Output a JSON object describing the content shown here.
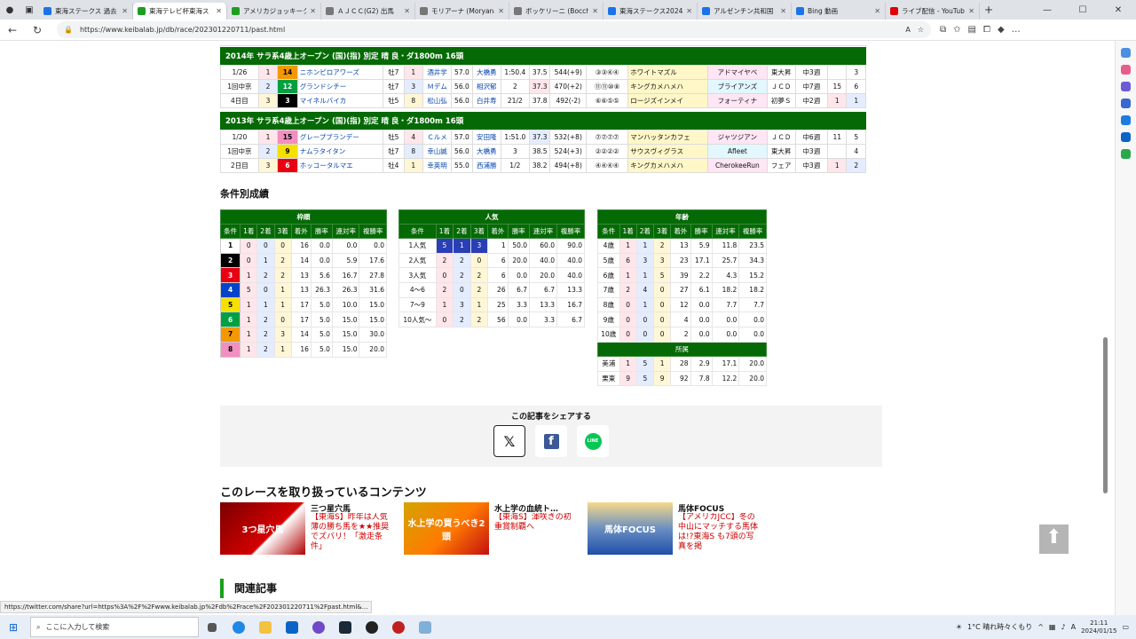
{
  "browser": {
    "tabs": [
      {
        "title": "東海ステークス 過去",
        "color": "#1a73e8"
      },
      {
        "title": "東海テレビ杯東海ス",
        "color": "#1e9e1e",
        "active": true
      },
      {
        "title": "アメリカジョッキーク",
        "color": "#1e9e1e"
      },
      {
        "title": "ＡＪＣＣ(G2) 出馬",
        "color": "#777777"
      },
      {
        "title": "モリアーナ (Moryana",
        "color": "#777777"
      },
      {
        "title": "ボッケリーニ (Bocche",
        "color": "#777777"
      },
      {
        "title": "東海ステークス2024",
        "color": "#1a73e8"
      },
      {
        "title": "アルゼンチン共和国",
        "color": "#1a73e8"
      },
      {
        "title": "Bing 動画",
        "color": "#1a73e8"
      },
      {
        "title": "ライブ配信 - YouTub",
        "color": "#e00000"
      }
    ],
    "url": "https://www.keibalab.jp/db/race/202301220711/past.html",
    "status_url": "https://twitter.com/share?url=https%3A%2F%2Fwww.keibalab.jp%2Fdb%2Frace%2F202301220711%2Fpast.html&..."
  },
  "past_races": [
    {
      "header": "2014年 サラ系4歳上オープン (国)(指) 別定 晴 良・ダ1800m 16頭",
      "date": [
        "1/26",
        "1回中京",
        "4日目"
      ],
      "rows": [
        {
          "rank": "1",
          "num": "14",
          "horse": "ニホンピロアワーズ",
          "sex": "牡7",
          "pop": "1",
          "jockey": "酒井学",
          "weight": "57.0",
          "trainer": "大橋勇",
          "time": "1:50.4",
          "last": "37.5",
          "bw": "544(+9)",
          "pos": "③③④④",
          "sire": "ホワイトマズル",
          "dam_sire": "アドマイヤベ",
          "owner": "東大昇",
          "prep": "中3週",
          "r1": "",
          "r2": "3"
        },
        {
          "rank": "2",
          "num": "12",
          "horse": "グランドシチー",
          "sex": "牡7",
          "pop": "3",
          "jockey": "Ｍデム",
          "weight": "56.0",
          "trainer": "相沢郁",
          "time": "2",
          "last": "37.3",
          "bw": "470(+2)",
          "pos": "⑪⑪⑩⑧",
          "sire": "キングカメハメハ",
          "dam_sire": "ブライアンズ",
          "owner": "ＪＣＤ",
          "prep": "中7週",
          "r1": "15",
          "r2": "6"
        },
        {
          "rank": "3",
          "num": "3",
          "horse": "マイネルバイカ",
          "sex": "牡5",
          "pop": "8",
          "jockey": "松山弘",
          "weight": "56.0",
          "trainer": "白井寿",
          "time": "21/2",
          "last": "37.8",
          "bw": "492(-2)",
          "pos": "⑥⑥⑤⑤",
          "sire": "ロージズインメイ",
          "dam_sire": "フォーティナ",
          "owner": "初夢Ｓ",
          "prep": "中2週",
          "r1": "1",
          "r2": "1"
        }
      ]
    },
    {
      "header": "2013年 サラ系4歳上オープン (国)(指) 別定 晴 良・ダ1800m 16頭",
      "date": [
        "1/20",
        "1回中京",
        "2日目"
      ],
      "rows": [
        {
          "rank": "1",
          "num": "15",
          "horse": "グレープブランデー",
          "sex": "牡5",
          "pop": "4",
          "jockey": "Ｃルメ",
          "weight": "57.0",
          "trainer": "安田隆",
          "time": "1:51.0",
          "last": "37.3",
          "bw": "532(+8)",
          "pos": "⑦⑦⑦⑦",
          "sire": "マンハッタンカフェ",
          "dam_sire": "ジャツジアン",
          "owner": "ＪＣＤ",
          "prep": "中6週",
          "r1": "11",
          "r2": "5"
        },
        {
          "rank": "2",
          "num": "9",
          "horse": "ナムラタイタン",
          "sex": "牡7",
          "pop": "8",
          "jockey": "幸山誠",
          "weight": "56.0",
          "trainer": "大橋勇",
          "time": "3",
          "last": "38.5",
          "bw": "524(+3)",
          "pos": "②②②②",
          "sire": "サウスヴィグラス",
          "dam_sire": "Afleet",
          "owner": "東大昇",
          "prep": "中3週",
          "r1": "",
          "r2": "4"
        },
        {
          "rank": "3",
          "num": "6",
          "horse": "ホッコータルマエ",
          "sex": "牡4",
          "pop": "1",
          "jockey": "幸英明",
          "weight": "55.0",
          "trainer": "西浦勝",
          "time": "1/2",
          "last": "38.2",
          "bw": "494(+8)",
          "pos": "④④④④",
          "sire": "キングカメハメハ",
          "dam_sire": "CherokeeRun",
          "owner": "フェア",
          "prep": "中3週",
          "r1": "1",
          "r2": "2"
        }
      ]
    }
  ],
  "cond_title": "条件別成績",
  "waku": {
    "title": "枠順",
    "cols": [
      "条件",
      "1着",
      "2着",
      "3着",
      "着外",
      "勝率",
      "連対率",
      "複勝率"
    ],
    "rows": [
      [
        "1",
        "0",
        "0",
        "0",
        "16",
        "0.0",
        "0.0",
        "0.0"
      ],
      [
        "2",
        "0",
        "1",
        "2",
        "14",
        "0.0",
        "5.9",
        "17.6"
      ],
      [
        "3",
        "1",
        "2",
        "2",
        "13",
        "5.6",
        "16.7",
        "27.8"
      ],
      [
        "4",
        "5",
        "0",
        "1",
        "13",
        "26.3",
        "26.3",
        "31.6"
      ],
      [
        "5",
        "1",
        "1",
        "1",
        "17",
        "5.0",
        "10.0",
        "15.0"
      ],
      [
        "6",
        "1",
        "2",
        "0",
        "17",
        "5.0",
        "15.0",
        "15.0"
      ],
      [
        "7",
        "1",
        "2",
        "3",
        "14",
        "5.0",
        "15.0",
        "30.0"
      ],
      [
        "8",
        "1",
        "2",
        "1",
        "16",
        "5.0",
        "15.0",
        "20.0"
      ]
    ]
  },
  "ninki": {
    "title": "人気",
    "cols": [
      "条件",
      "1着",
      "2着",
      "3着",
      "着外",
      "勝率",
      "連対率",
      "複勝率"
    ],
    "rows": [
      [
        "1人気",
        "5",
        "1",
        "3",
        "1",
        "50.0",
        "60.0",
        "90.0"
      ],
      [
        "2人気",
        "2",
        "2",
        "0",
        "6",
        "20.0",
        "40.0",
        "40.0"
      ],
      [
        "3人気",
        "0",
        "2",
        "2",
        "6",
        "0.0",
        "20.0",
        "40.0"
      ],
      [
        "4～6",
        "2",
        "0",
        "2",
        "26",
        "6.7",
        "6.7",
        "13.3"
      ],
      [
        "7～9",
        "1",
        "3",
        "1",
        "25",
        "3.3",
        "13.3",
        "16.7"
      ],
      [
        "10人気～",
        "0",
        "2",
        "2",
        "56",
        "0.0",
        "3.3",
        "6.7"
      ]
    ]
  },
  "nenrei": {
    "title": "年齢",
    "cols": [
      "条件",
      "1着",
      "2着",
      "3着",
      "着外",
      "勝率",
      "連対率",
      "複勝率"
    ],
    "rows": [
      [
        "4歳",
        "1",
        "1",
        "2",
        "13",
        "5.9",
        "11.8",
        "23.5"
      ],
      [
        "5歳",
        "6",
        "3",
        "3",
        "23",
        "17.1",
        "25.7",
        "34.3"
      ],
      [
        "6歳",
        "1",
        "1",
        "5",
        "39",
        "2.2",
        "4.3",
        "15.2"
      ],
      [
        "7歳",
        "2",
        "4",
        "0",
        "27",
        "6.1",
        "18.2",
        "18.2"
      ],
      [
        "8歳",
        "0",
        "1",
        "0",
        "12",
        "0.0",
        "7.7",
        "7.7"
      ],
      [
        "9歳",
        "0",
        "0",
        "0",
        "4",
        "0.0",
        "0.0",
        "0.0"
      ],
      [
        "10歳",
        "0",
        "0",
        "0",
        "2",
        "0.0",
        "0.0",
        "0.0"
      ]
    ],
    "sub_title": "所属",
    "sub_rows": [
      [
        "美浦",
        "1",
        "5",
        "1",
        "28",
        "2.9",
        "17.1",
        "20.0"
      ],
      [
        "栗東",
        "9",
        "5",
        "9",
        "92",
        "7.8",
        "12.2",
        "20.0"
      ]
    ]
  },
  "waku_colors": [
    "#ffffff",
    "#000000",
    "#e60012",
    "#0044cc",
    "#f5e000",
    "#00a040",
    "#f39800",
    "#f28fc0"
  ],
  "waku_text": [
    "#000000",
    "#ffffff",
    "#ffffff",
    "#ffffff",
    "#000000",
    "#ffffff",
    "#000000",
    "#000000"
  ],
  "share": {
    "title": "この記事をシェアする",
    "x": "𝕏",
    "facebook": "f",
    "line": "LINE"
  },
  "contents": {
    "title": "このレースを取り扱っているコンテンツ",
    "cards": [
      {
        "name": "三つ星穴馬",
        "img": "3つ星穴馬",
        "desc": "【東海S】昨年は人気薄の勝ち馬を★★推奨でズバリ！「激走条件」"
      },
      {
        "name": "水上学の血統ト…",
        "img": "水上学の買うべき2頭",
        "desc": "【東海S】渾咲きの初重賞制覇へ"
      },
      {
        "name": "馬体FOCUS",
        "img": "馬体FOCUS",
        "desc": "【アメリカJCC】冬の中山にマッチする馬体は!?東海S も7頭の写真を掲"
      }
    ]
  },
  "related_title": "関連記事",
  "taskbar": {
    "search_placeholder": "ここに入力して検索",
    "weather": "1°C 晴れ時々くもり",
    "time": "21:11",
    "date": "2024/01/15"
  }
}
